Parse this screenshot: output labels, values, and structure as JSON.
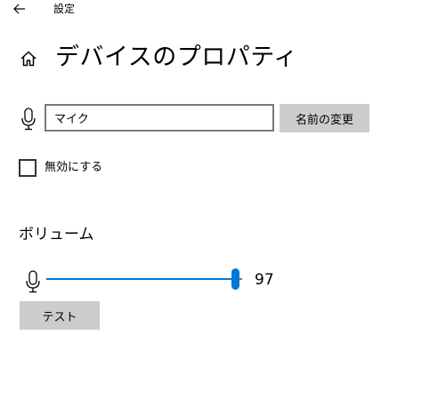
{
  "app": {
    "title": "設定",
    "back_icon": "arrow-left-icon"
  },
  "header": {
    "home_icon": "home-icon",
    "title": "デバイスのプロパティ"
  },
  "device_name": {
    "icon": "microphone-icon",
    "value": "マイク",
    "rename_label": "名前の変更"
  },
  "disable": {
    "label": "無効にする",
    "checked": false
  },
  "volume": {
    "heading": "ボリューム",
    "icon": "microphone-icon",
    "value": 97,
    "value_text": "97",
    "max": 100,
    "accent": "#0078d7",
    "test_label": "テスト"
  }
}
